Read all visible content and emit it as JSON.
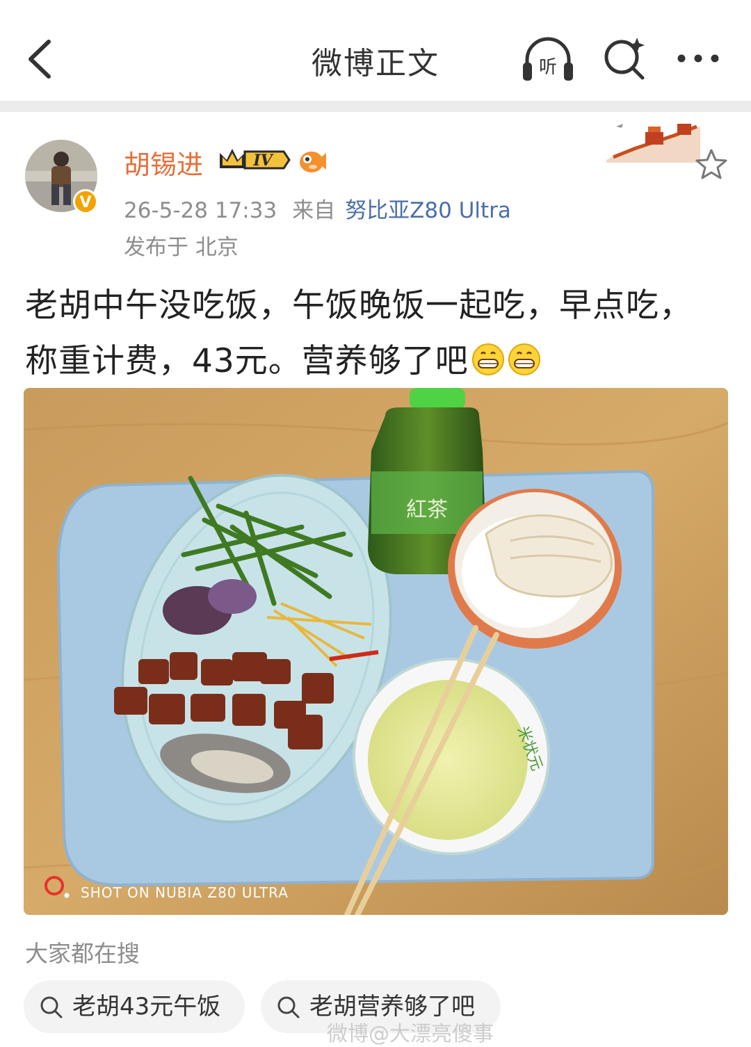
{
  "topbar": {
    "title": "微博正文",
    "listen_label": "听"
  },
  "author": {
    "name": "胡锡进",
    "level_badge": "IV",
    "verified_mark": "V",
    "timestamp": "26-5-28 17:33",
    "from_label": "来自",
    "device": "努比亚Z80 Ultra",
    "location": "发布于 北京"
  },
  "post": {
    "text": "老胡中午没吃饭，午饭晚饭一起吃，早点吃，称重计费，43元。营养够了吧"
  },
  "photo": {
    "watermark": "SHOT ON NUBIA Z80 ULTRA",
    "bowl_text": "米状元"
  },
  "search": {
    "heading": "大家都在搜",
    "chips": [
      {
        "label": "老胡43元午饭"
      },
      {
        "label": "老胡营养够了吧"
      }
    ]
  },
  "footer": {
    "watermark": "微博@大漂亮傻事"
  },
  "colors": {
    "username": "#e4703a",
    "source_link": "#4a6ea8",
    "meta_gray": "#8d8d8d",
    "chip_bg": "#f3f3f3"
  }
}
